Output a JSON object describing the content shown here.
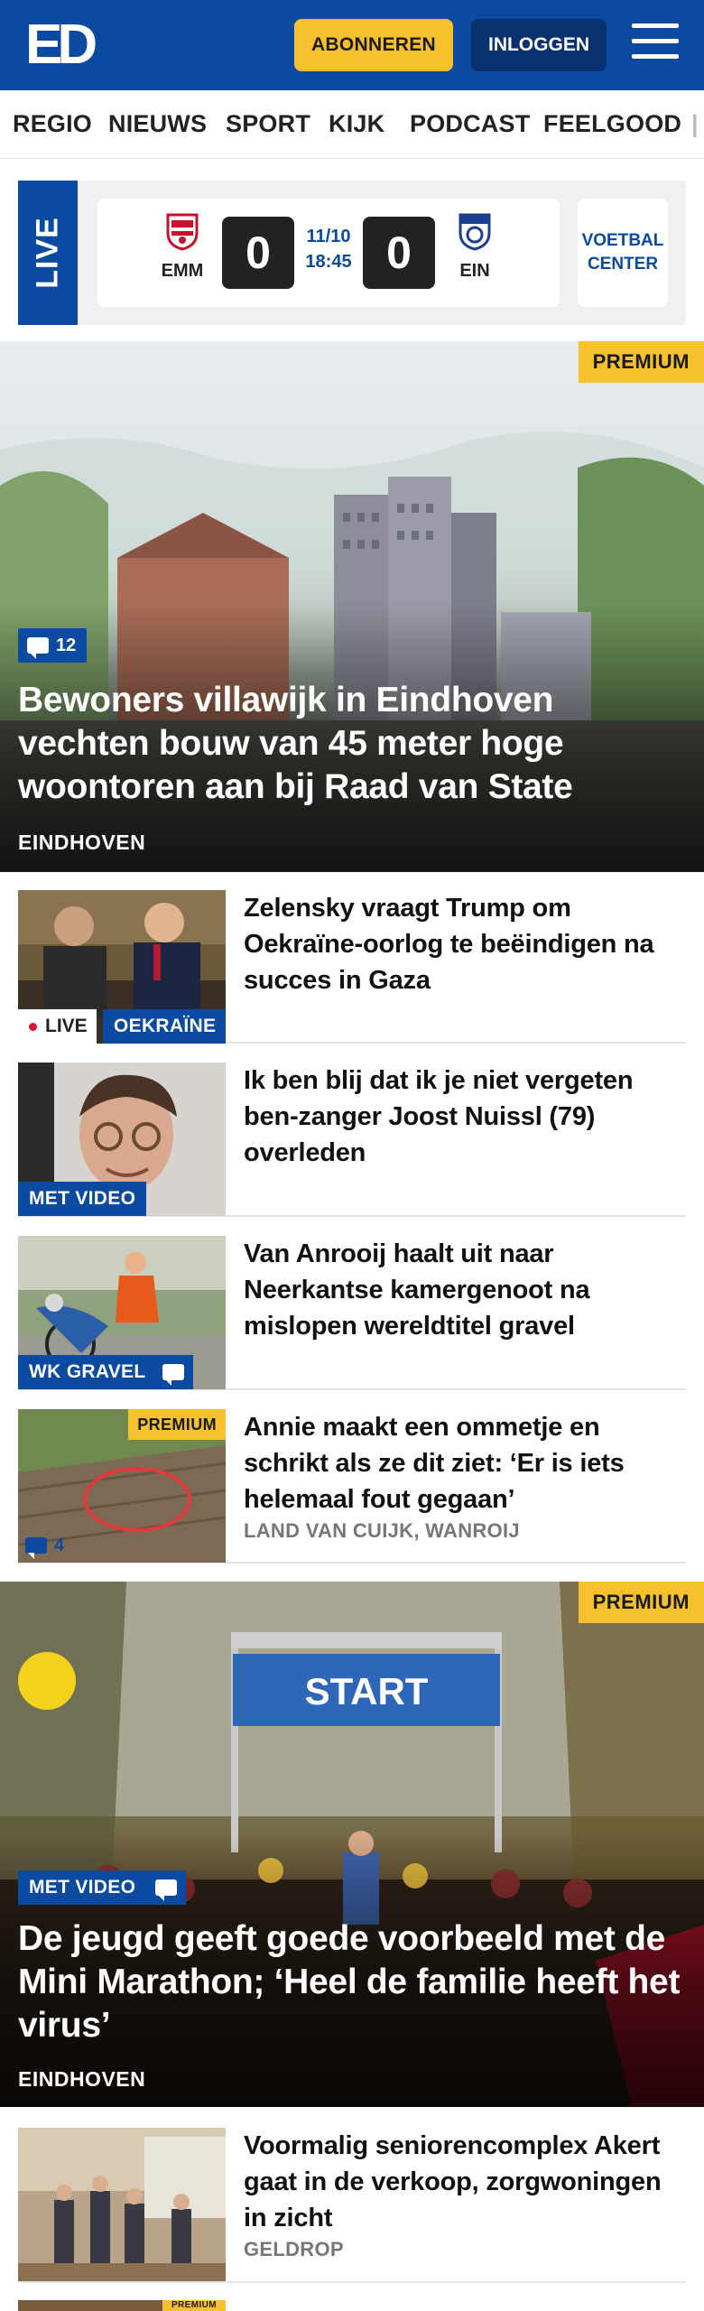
{
  "header": {
    "logo_text": "ED",
    "subscribe_label": "ABONNEREN",
    "login_label": "INLOGGEN",
    "menu_icon": "hamburger-menu-icon",
    "brand_color": "#0b4aa1",
    "accent_color": "#f7c12e"
  },
  "nav": {
    "items": [
      "REGIO",
      "NIEUWS",
      "SPORT",
      "KIJK",
      "PODCAST",
      "FEELGOOD"
    ]
  },
  "live": {
    "tab_label": "LIVE",
    "match": {
      "home_abbr": "EMM",
      "home_score": "0",
      "away_abbr": "EIN",
      "away_score": "0",
      "date": "11/10",
      "time": "18:45"
    },
    "voetbal_center_label": "VOETBAL CENTER"
  },
  "hero1": {
    "premium_label": "PREMIUM",
    "comment_count": "12",
    "title": "Bewoners villawijk in Eindhoven vechten bouw van 45 meter hoge woontoren aan bij Raad van State",
    "location": "EINDHOVEN"
  },
  "articles": [
    {
      "title": "Zelensky vraagt Trump om Oekraïne-oorlog te beëindigen na succes in Gaza",
      "live_label": "LIVE",
      "category": "OEKRAÏNE"
    },
    {
      "title": "Ik ben blij dat ik je niet vergeten ben-zanger Joost Nuissl (79) overleden",
      "category": "MET VIDEO"
    },
    {
      "title": "Van Anrooij haalt uit naar Neerkantse kamergenoot na mislopen wereldtitel gravel",
      "category": "WK GRAVEL"
    },
    {
      "title": "Annie maakt een ommetje en schrikt als ze dit ziet: ‘Er is iets helemaal fout gegaan’",
      "premium_label": "PREMIUM",
      "comment_count": "4",
      "location": "LAND VAN CUIJK, WANROIJ"
    }
  ],
  "hero2": {
    "premium_label": "PREMIUM",
    "video_label": "MET VIDEO",
    "title": "De jeugd geeft goede voorbeeld met de Mini Marathon; ‘Heel de familie heeft het virus’",
    "location": "EINDHOVEN",
    "arch_text": "START"
  },
  "article5": {
    "title": "Voormalig seniorencomplex Akert gaat in de verkoop, zorgwoningen in zicht",
    "location": "GELDROP"
  },
  "article6": {
    "premium_label": "PREMIUM"
  }
}
